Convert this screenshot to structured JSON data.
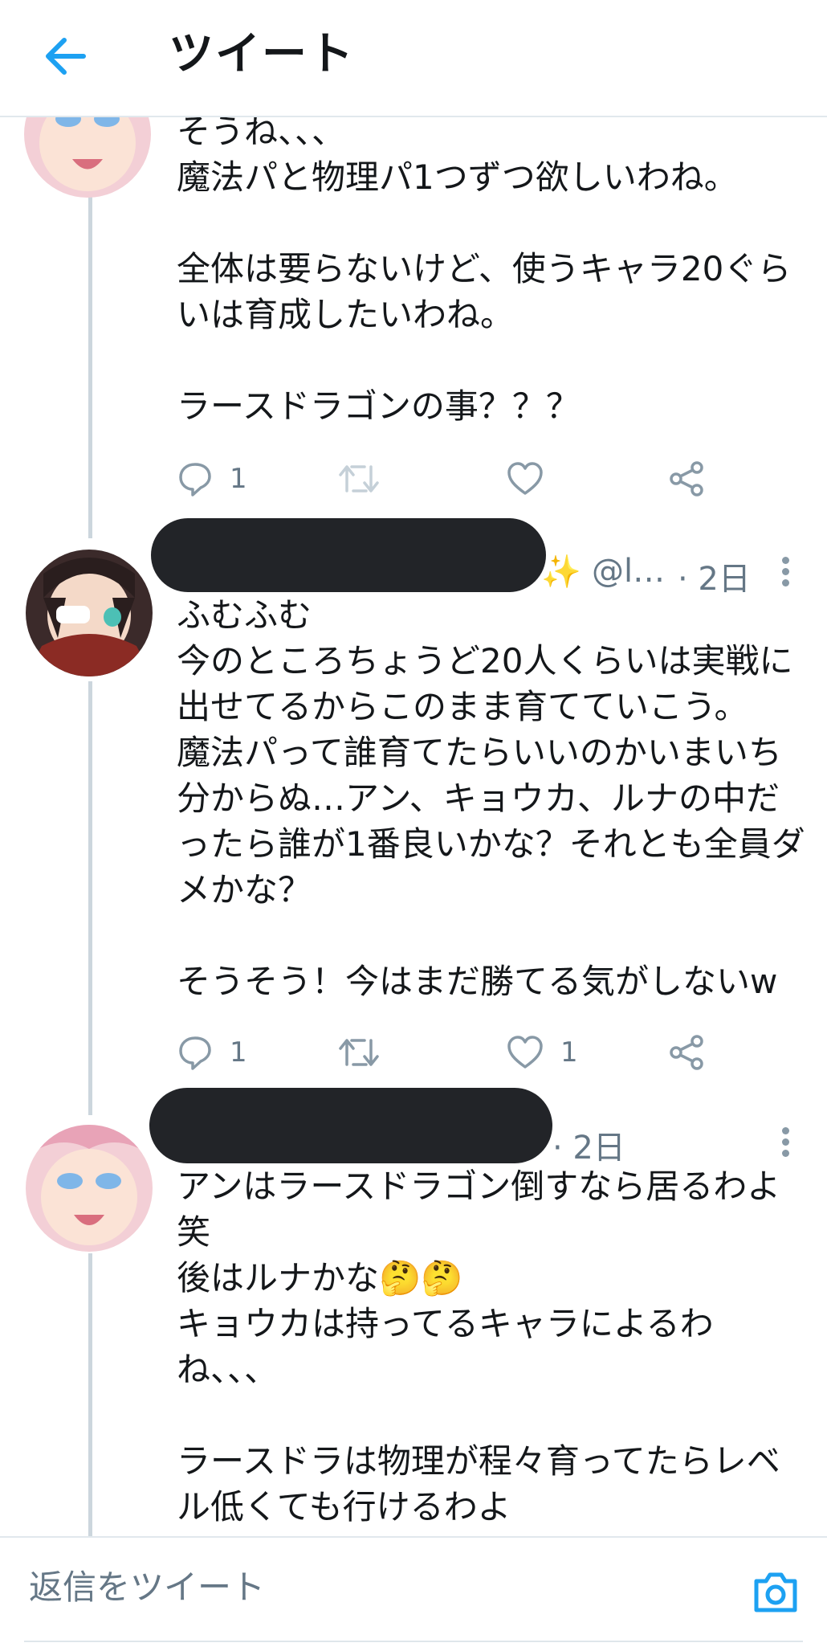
{
  "header": {
    "title": "ツイート"
  },
  "tweets": [
    {
      "text": "そうね、、、\n魔法パと物理パ1つずつ欲しいわね。\n\n全体は要らないけど、使うキャラ20ぐらいは育成したいわね。\n\nラースドラゴンの事？？？",
      "reply_count": "1",
      "like_count": ""
    },
    {
      "handle": "@l…",
      "time": "· 2日",
      "text": "ふむふむ\n今のところちょうど20人くらいは実戦に出せてるからこのまま育てていこう。\n魔法パって誰育てたらいいのかいまいち分からぬ…アン、キョウカ、ルナの中だったら誰が1番良いかな？それとも全員ダメかな？\n\nそうそう！今はまだ勝てる気がしないw",
      "reply_count": "1",
      "like_count": "1"
    },
    {
      "time": "· 2日",
      "text": "アンはラースドラゴン倒すなら居るわよ笑\n後はルナかな🤔🤔\nキョウカは持ってるキャラによるわね、、、\n\nラースドラは物理が程々育ってたらレベル低くても行けるわよ"
    }
  ],
  "reply_bar": {
    "placeholder": "返信をツイート"
  },
  "colors": {
    "accent": "#1da1f2",
    "text": "#14171a",
    "muted": "#657786"
  }
}
